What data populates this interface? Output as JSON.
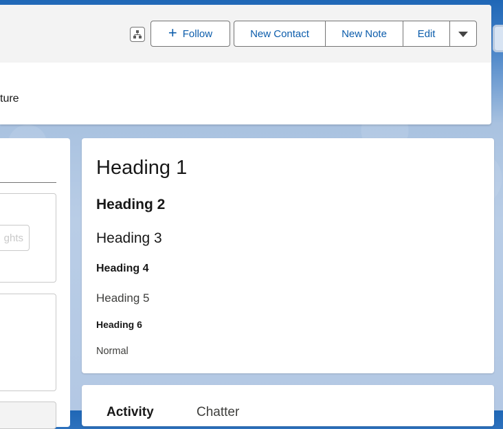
{
  "header": {
    "actions": {
      "follow_label": "Follow",
      "new_contact_label": "New Contact",
      "new_note_label": "New Note",
      "edit_label": "Edit"
    },
    "subtitle_fragment": "ture"
  },
  "left_panel": {
    "insights_button_fragment": "ghts"
  },
  "content_card": {
    "heading1": "Heading 1",
    "heading2": "Heading 2",
    "heading3": "Heading 3",
    "heading4": "Heading 4",
    "heading5": "Heading 5",
    "heading6": "Heading 6",
    "normal": "Normal"
  },
  "activity_card": {
    "tab_activity": "Activity",
    "tab_chatter": "Chatter"
  },
  "colors": {
    "brand_blue": "#0b5cab",
    "border_gray": "#747474"
  },
  "icons": {
    "hierarchy": "hierarchy-icon",
    "add": "add-icon",
    "more": "chevron-down-icon"
  }
}
